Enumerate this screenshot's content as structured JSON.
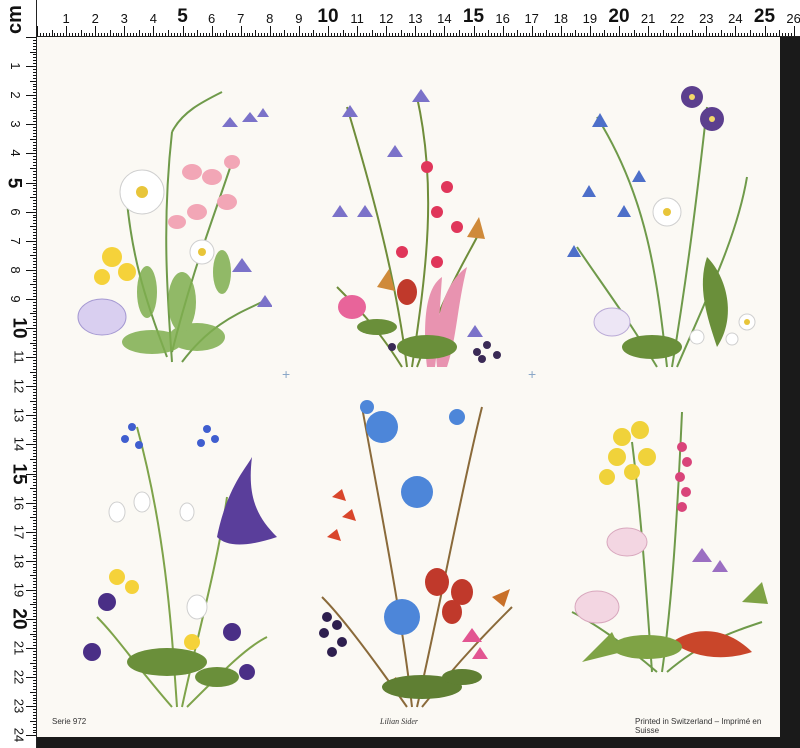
{
  "ruler": {
    "unit_label": "cm",
    "top_numbers": [
      "1",
      "2",
      "3",
      "4",
      "5",
      "6",
      "7",
      "8",
      "9",
      "10",
      "11",
      "12",
      "13",
      "14",
      "15",
      "16",
      "17",
      "18",
      "19",
      "20",
      "21",
      "22",
      "23",
      "24",
      "25",
      "26"
    ],
    "left_numbers": [
      "1",
      "2",
      "3",
      "4",
      "5",
      "6",
      "7",
      "8",
      "9",
      "10",
      "11",
      "12",
      "13",
      "14",
      "15",
      "16",
      "17",
      "18",
      "19",
      "20",
      "21",
      "22",
      "23",
      "24"
    ]
  },
  "sheet": {
    "series_label": "Serie 972",
    "signature": "Lilian Sider",
    "printed_label": "Printed in Switzerland – Imprimé en Suisse"
  },
  "bouquets": [
    {
      "name": "wildflower-bouquet-1",
      "icon": "daisy-bellflower-bouquet"
    },
    {
      "name": "wildflower-bouquet-2",
      "icon": "berry-bellflower-bouquet"
    },
    {
      "name": "wildflower-bouquet-3",
      "icon": "pansy-bluebell-bouquet"
    },
    {
      "name": "wildflower-bouquet-4",
      "icon": "crocus-violet-bouquet"
    },
    {
      "name": "wildflower-bouquet-5",
      "icon": "chicory-rosehip-bouquet"
    },
    {
      "name": "wildflower-bouquet-6",
      "icon": "primrose-hellebore-bouquet"
    }
  ],
  "colors": {
    "paper": "#fbf9f4",
    "frame": "#1a1a1a",
    "registration": "#8aa7c7"
  }
}
